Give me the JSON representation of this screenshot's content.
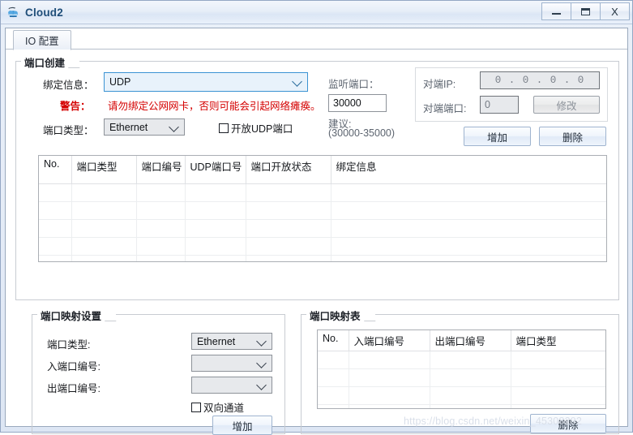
{
  "window": {
    "title": "Cloud2",
    "app_icon": "cloud-icon",
    "controls": {
      "minimize": "minimize-icon",
      "maximize": "maximize-icon",
      "close": "X"
    }
  },
  "tabs": [
    {
      "label": "IO 配置",
      "active": true
    }
  ],
  "port_create": {
    "group_title": "端口创建",
    "binding_label": "绑定信息：",
    "binding_value": "UDP",
    "warning_label": "警告：",
    "warning_text": "请勿绑定公网网卡，否则可能会引起网络瘫痪。",
    "port_type_label": "端口类型：",
    "port_type_value": "Ethernet",
    "open_udp_checkbox": "开放UDP端口",
    "listen_port_label": "监听端口：",
    "listen_port_value": "30000",
    "suggestion_line1": "建议:",
    "suggestion_line2": "(30000-35000)",
    "peer_ip_label": "对端IP:",
    "peer_ip_value": "0 . 0 . 0 . 0",
    "peer_port_label": "对端端口:",
    "peer_port_value": "0",
    "modify_button": "修改",
    "add_button": "增加",
    "delete_button": "删除"
  },
  "port_table": {
    "columns": [
      "No.",
      "端口类型",
      "端口编号",
      "UDP端口号",
      "端口开放状态",
      "绑定信息"
    ],
    "rows": [],
    "empty_row_count": 6
  },
  "mapping_settings": {
    "group_title": "端口映射设置",
    "port_type_label": "端口类型:",
    "port_type_value": "Ethernet",
    "in_port_label": "入端口编号:",
    "in_port_value": "",
    "out_port_label": "出端口编号:",
    "out_port_value": "",
    "bidirectional_checkbox": "双向通道",
    "add_button": "增加"
  },
  "mapping_table": {
    "group_title": "端口映射表",
    "columns": [
      "No.",
      "入端口编号",
      "出端口编号",
      "端口类型"
    ],
    "rows": [],
    "empty_row_count": 5,
    "delete_button": "删除"
  },
  "watermark": "https://blog.csdn.net/weixin_45308292",
  "colors": {
    "accent": "#1f4e79",
    "warning": "#d40000",
    "combo_focus_border": "#3b93d3",
    "combo_focus_bg": "#e8f2fb"
  }
}
